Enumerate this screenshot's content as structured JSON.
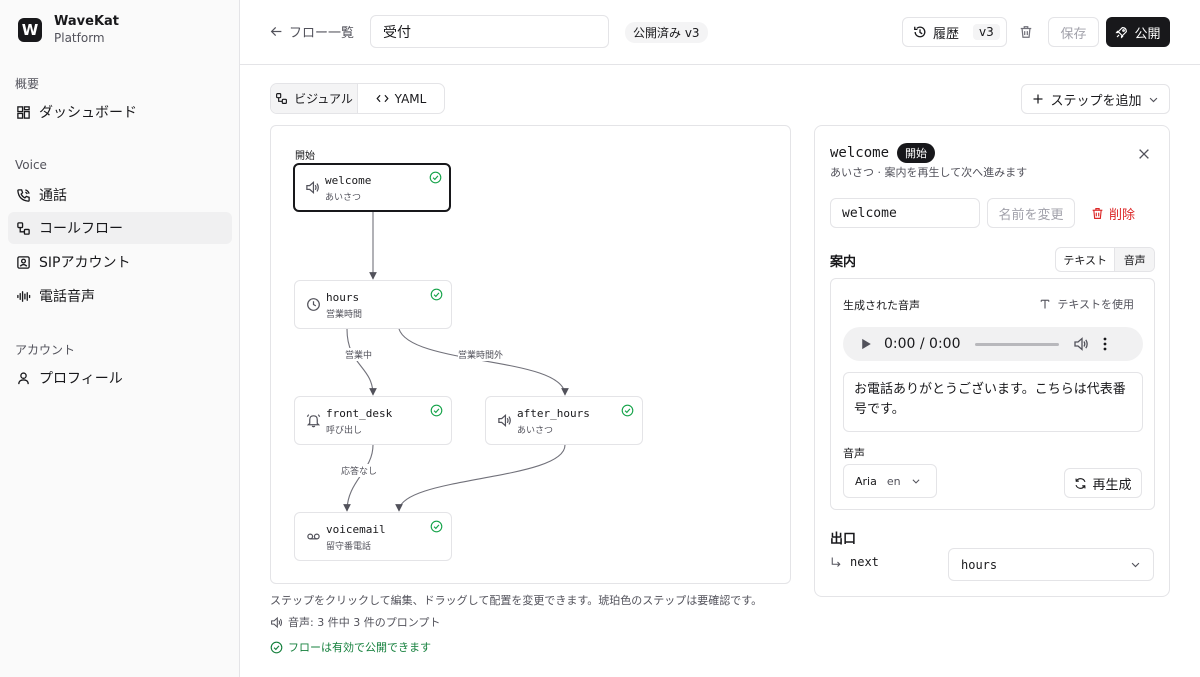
{
  "brand": {
    "logo_letter": "W",
    "name": "WaveKat",
    "subtitle": "Platform"
  },
  "sidebar": {
    "sections": [
      {
        "label": "概要",
        "items": [
          {
            "label": "ダッシュボード",
            "icon": "dashboard-icon",
            "active": false
          }
        ]
      },
      {
        "label": "Voice",
        "items": [
          {
            "label": "通話",
            "icon": "phone-icon",
            "active": false
          },
          {
            "label": "コールフロー",
            "icon": "workflow-icon",
            "active": true
          },
          {
            "label": "SIPアカウント",
            "icon": "contact-icon",
            "active": false
          },
          {
            "label": "電話音声",
            "icon": "waveform-icon",
            "active": false
          }
        ]
      },
      {
        "label": "アカウント",
        "items": [
          {
            "label": "プロフィール",
            "icon": "user-icon",
            "active": false
          }
        ]
      }
    ]
  },
  "header": {
    "back_label": "フロー一覧",
    "flow_name": "受付",
    "status": "公開済み v3",
    "history_label": "履歴",
    "history_version": "v3",
    "save_label": "保存",
    "publish_label": "公開"
  },
  "toolbar": {
    "view_tabs": [
      {
        "label": "ビジュアル",
        "active": true
      },
      {
        "label": "YAML",
        "active": false
      }
    ],
    "add_step_label": "ステップを追加"
  },
  "canvas": {
    "start_label": "開始",
    "nodes": [
      {
        "name": "welcome",
        "type": "あいさつ",
        "icon": "speaker-icon",
        "selected": true,
        "valid": true
      },
      {
        "name": "hours",
        "type": "営業時間",
        "icon": "clock-icon",
        "selected": false,
        "valid": true
      },
      {
        "name": "front_desk",
        "type": "呼び出し",
        "icon": "bell-icon",
        "selected": false,
        "valid": true
      },
      {
        "name": "after_hours",
        "type": "あいさつ",
        "icon": "speaker-icon",
        "selected": false,
        "valid": true
      },
      {
        "name": "voicemail",
        "type": "留守番電話",
        "icon": "voicemail-icon",
        "selected": false,
        "valid": true
      }
    ],
    "edge_labels": {
      "open": "営業中",
      "closed": "営業時間外",
      "no_answer": "応答なし"
    }
  },
  "footer": {
    "hint": "ステップをクリックして編集、ドラッグして配置を変更できます。琥珀色のステップは要確認です。",
    "voice_status": "音声: 3 件中 3 件のプロンプト",
    "valid_status": "フローは有効で公開できます"
  },
  "panel": {
    "step_name": "welcome",
    "start_badge": "開始",
    "description": "あいさつ · 案内を再生して次へ進みます",
    "name_input_value": "welcome",
    "rename_label": "名前を変更",
    "delete_label": "削除",
    "prompt_section": "案内",
    "prompt_modes": [
      {
        "label": "テキスト",
        "active": false
      },
      {
        "label": "音声",
        "active": true
      }
    ],
    "generated_audio_label": "生成された音声",
    "use_text_label": "テキストを使用",
    "audio_time": "0:00 / 0:00",
    "tts_text": "お電話ありがとうございます。こちらは代表番号です。",
    "voice_label": "音声",
    "voice_name": "Aria",
    "voice_lang": "en",
    "regen_label": "再生成",
    "exit_section": "出口",
    "exit_name": "next",
    "exit_target": "hours"
  },
  "colors": {
    "accent": "#18181b",
    "valid": "#16a34a",
    "danger": "#dc2626"
  }
}
